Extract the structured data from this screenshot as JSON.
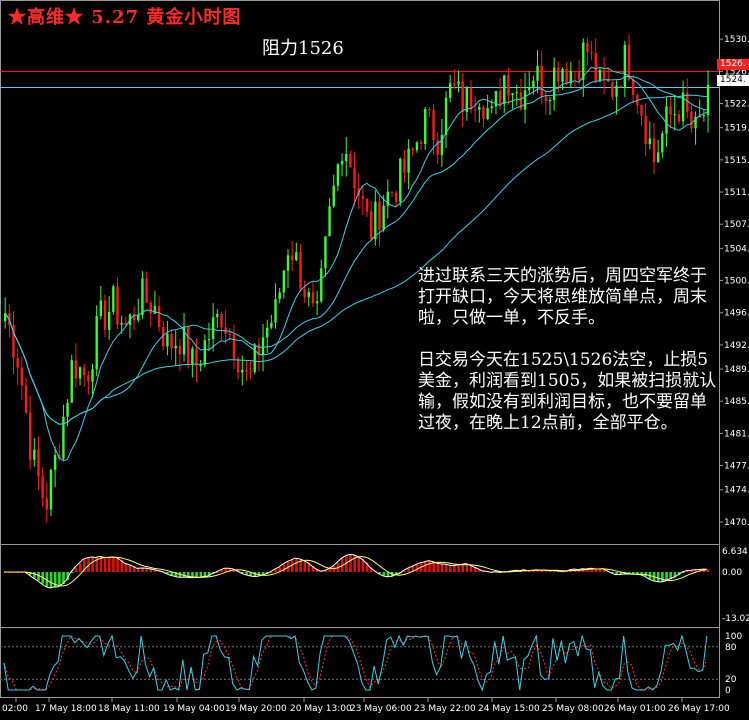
{
  "header": {
    "title": "★高维★ 5.27 黄金小时图",
    "resistance_label": "阻力1526"
  },
  "annotation": {
    "paragraph_1": "进过联系三天的涨势后，周四空军终于打开缺口，今天将思维放简单点，周末啦，只做一单，不反手。",
    "paragraph_2": "日交易今天在1525\\1526法空，止损5美金，利润看到1505，如果被扫损就认输，假如没有到利润目标，也不要留单过夜，在晚上12点前，全部平仓。"
  },
  "price_axis": {
    "ticks": [
      "1530.",
      "1526.",
      "1522.",
      "1519.",
      "1515.",
      "1511.",
      "1507.",
      "1504.",
      "1500.",
      "1496.",
      "1492.",
      "1489.",
      "1485.",
      "1481.",
      "1477.",
      "1474.",
      "1470."
    ],
    "resistance_tag": "1526.",
    "current_tag": "1524."
  },
  "macd_axis": {
    "top": "6.634",
    "zero": "0.00",
    "bottom": "-13.02"
  },
  "osc_axis": {
    "labels": [
      "100",
      "80",
      "20",
      "0"
    ]
  },
  "time_axis": {
    "labels": [
      "02:00",
      "17 May 18:00",
      "18 May 11:00",
      "19 May 04:00",
      "19 May 20:00",
      "20 May 13:00",
      "23 May 06:00",
      "23 May 22:00",
      "24 May 15:00",
      "25 May 08:00",
      "26 May 01:00",
      "26 May 17:00"
    ]
  },
  "chart_data": {
    "type": "candlestick",
    "instrument": "黄金",
    "ylim": [
      1468,
      1534
    ],
    "horizontal_lines": [
      {
        "value": 1526,
        "color": "#ff2020"
      },
      {
        "value": 1524,
        "color": "#55c8ff"
      }
    ],
    "closes": [
      1496,
      1490,
      1478,
      1472,
      1480,
      1490,
      1488,
      1495,
      1497,
      1494,
      1498,
      1497,
      1492,
      1493,
      1489,
      1493,
      1496,
      1492,
      1487,
      1493,
      1496,
      1505,
      1500,
      1494,
      1508,
      1518,
      1512,
      1506,
      1510,
      1512,
      1515,
      1520,
      1518,
      1524,
      1522,
      1524,
      1520,
      1526,
      1523,
      1526,
      1524,
      1527,
      1526,
      1529,
      1524,
      1524,
      1528,
      1522,
      1515,
      1520,
      1522,
      1518,
      1522
    ],
    "up_color": "#33ff33",
    "down_color": "#ff1a1a",
    "ma_color": "#36d3e6",
    "macd_colors": {
      "positive": "#e01010",
      "negative": "#22dd22",
      "signal": "#ffff66",
      "line": "#ffffff"
    },
    "osc_colors": {
      "main": "#36d3e6",
      "signal": "#ff3030"
    }
  }
}
